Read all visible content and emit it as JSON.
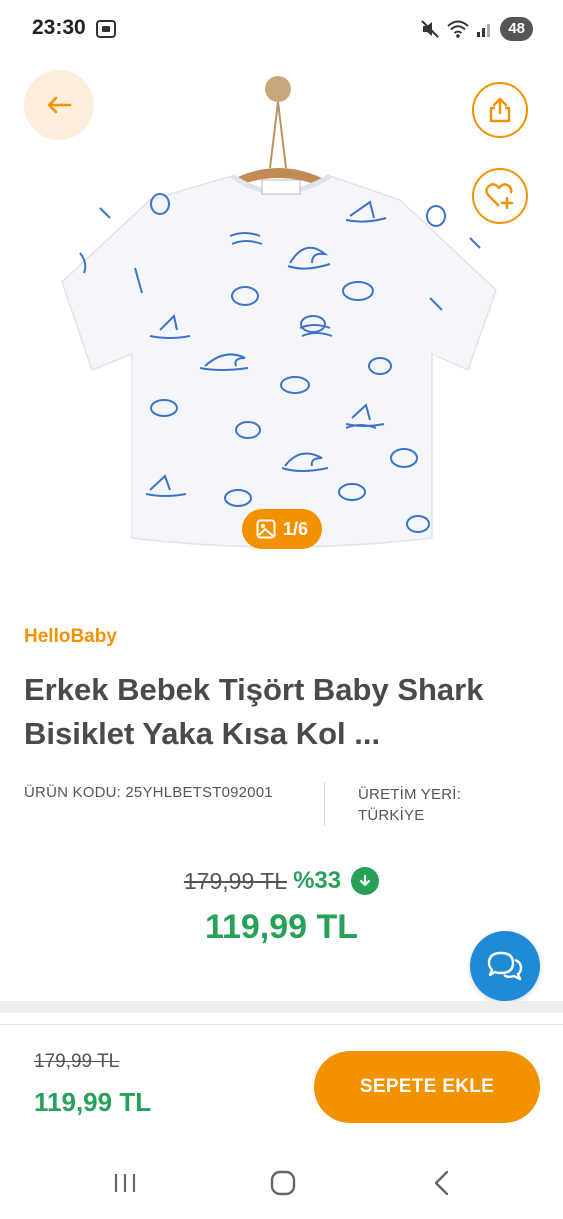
{
  "status_bar": {
    "time": "23:30",
    "battery_level": "48",
    "icons": [
      "screenshot-icon",
      "mute-icon",
      "wifi-icon",
      "signal-icon"
    ]
  },
  "product": {
    "image_counter": "1/6",
    "brand": "HelloBaby",
    "title": "Erkek Bebek Tişört Baby Shark Bisiklet Yaka Kısa Kol ...",
    "product_code": "ÜRÜN KODU: 25YHLBETST092001",
    "origin_line1": "ÜRETİM YERİ:",
    "origin_line2": "TÜRKİYE",
    "old_price": "179,99 TL",
    "discount": "%33",
    "current_price": "119,99 TL"
  },
  "bottom_bar": {
    "old_price": "179,99 TL",
    "current_price": "119,99 TL",
    "add_to_cart_label": "SEPETE EKLE"
  },
  "colors": {
    "accent": "#f39200",
    "price_green": "#27a05a",
    "chat_blue": "#1f8ad6",
    "shirt_print": "#3b74c9"
  },
  "icons": {
    "back": "arrow-left-icon",
    "share": "share-icon",
    "favorite": "heart-plus-icon",
    "gallery": "image-icon",
    "discount": "arrow-down-circle-icon",
    "chat": "chat-bubbles-icon"
  }
}
